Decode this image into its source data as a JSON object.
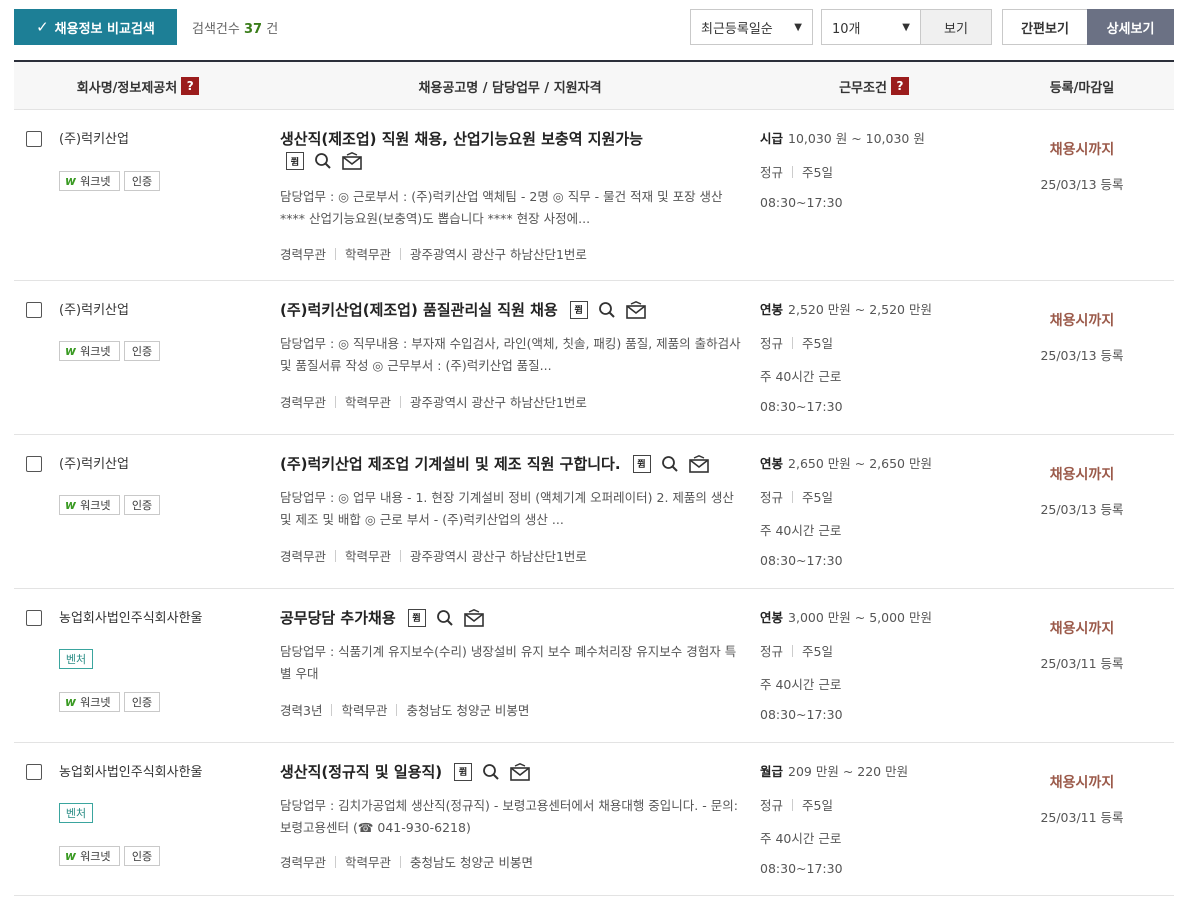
{
  "toolbar": {
    "compare_label": "채용정보 비교검색",
    "count_label": "검색건수",
    "count_value": "37",
    "count_unit": "건",
    "sort_value": "최근등록일순",
    "per_page_value": "10개",
    "view_label": "보기",
    "simple_view_label": "간편보기",
    "detail_view_label": "상세보기"
  },
  "header": {
    "company": "회사명/정보제공처",
    "posting": "채용공고명 / 담당업무 / 지원자격",
    "conditions": "근무조건",
    "dates": "등록/마감일",
    "help_mark": "?"
  },
  "tags": {
    "worknet": "워크넷",
    "certified": "인증",
    "venture": "벤처",
    "worknet_letter": "w"
  },
  "icon_text": {
    "memo": "쮬"
  },
  "rows": [
    {
      "company": "(주)럭키산업",
      "title": "생산직(제조업) 직원 채용, 산업기능요원 보충역 지원가능",
      "duty": "담당업무 : ◎ 근로부서 : (주)럭키산업 액체팀 - 2명 ◎ 직무 - 물건 적재 및 포장 생산 **** 산업기능요원(보충역)도 뽑습니다 **** 현장 사정에...",
      "career": "경력무관",
      "education": "학력무관",
      "location": "광주광역시 광산구 하남산단1번로",
      "pay_type": "시급",
      "pay": "10,030 원 ~ 10,030 원",
      "employment": "정규",
      "week": "주5일",
      "hours_week": "",
      "work_time": "08:30~17:30",
      "deadline": "채용시까지",
      "registered": "25/03/13 등록"
    },
    {
      "company": "(주)럭키산업",
      "title": "(주)럭키산업(제조업) 품질관리실 직원 채용",
      "duty": "담당업무 : ◎ 직무내용 : 부자재 수입검사, 라인(액체, 칫솔, 패킹) 품질, 제품의 출하검사 및 품질서류 작성 ◎ 근무부서 : (주)럭키산업 품질...",
      "career": "경력무관",
      "education": "학력무관",
      "location": "광주광역시 광산구 하남산단1번로",
      "pay_type": "연봉",
      "pay": "2,520 만원 ~ 2,520 만원",
      "employment": "정규",
      "week": "주5일",
      "hours_week": "주 40시간 근로",
      "work_time": "08:30~17:30",
      "deadline": "채용시까지",
      "registered": "25/03/13 등록"
    },
    {
      "company": "(주)럭키산업",
      "title": "(주)럭키산업 제조업 기계설비 및 제조 직원 구합니다.",
      "duty": "담당업무 : ◎ 업무 내용 - 1. 현장 기계설비 정비 (액체기계 오퍼레이터) 2. 제품의 생산 및 제조 및 배합 ◎ 근로 부서 - (주)럭키산업의 생산 ...",
      "career": "경력무관",
      "education": "학력무관",
      "location": "광주광역시 광산구 하남산단1번로",
      "pay_type": "연봉",
      "pay": "2,650 만원 ~ 2,650 만원",
      "employment": "정규",
      "week": "주5일",
      "hours_week": "주 40시간 근로",
      "work_time": "08:30~17:30",
      "deadline": "채용시까지",
      "registered": "25/03/13 등록"
    },
    {
      "company": "농업회사법인주식회사한울",
      "title": "공무당담 추가채용",
      "duty": "담당업무 : 식품기계 유지보수(수리) 냉장설비 유지 보수 폐수처리장 유지보수 경험자 특별 우대",
      "career": "경력3년",
      "education": "학력무관",
      "location": "충청남도 청양군 비봉면",
      "pay_type": "연봉",
      "pay": "3,000 만원 ~ 5,000 만원",
      "employment": "정규",
      "week": "주5일",
      "hours_week": "주 40시간 근로",
      "work_time": "08:30~17:30",
      "deadline": "채용시까지",
      "registered": "25/03/11 등록"
    },
    {
      "company": "농업회사법인주식회사한울",
      "title": "생산직(정규직 및 일용직)",
      "duty": "담당업무 : 김치가공업체 생산직(정규직) - 보령고용센터에서 채용대행 중입니다. - 문의: 보령고용센터 (☎ 041-930-6218)",
      "career": "경력무관",
      "education": "학력무관",
      "location": "충청남도 청양군 비봉면",
      "pay_type": "월급",
      "pay": "209 만원 ~ 220 만원",
      "employment": "정규",
      "week": "주5일",
      "hours_week": "주 40시간 근로",
      "work_time": "08:30~17:30",
      "deadline": "채용시까지",
      "registered": "25/03/11 등록"
    }
  ]
}
